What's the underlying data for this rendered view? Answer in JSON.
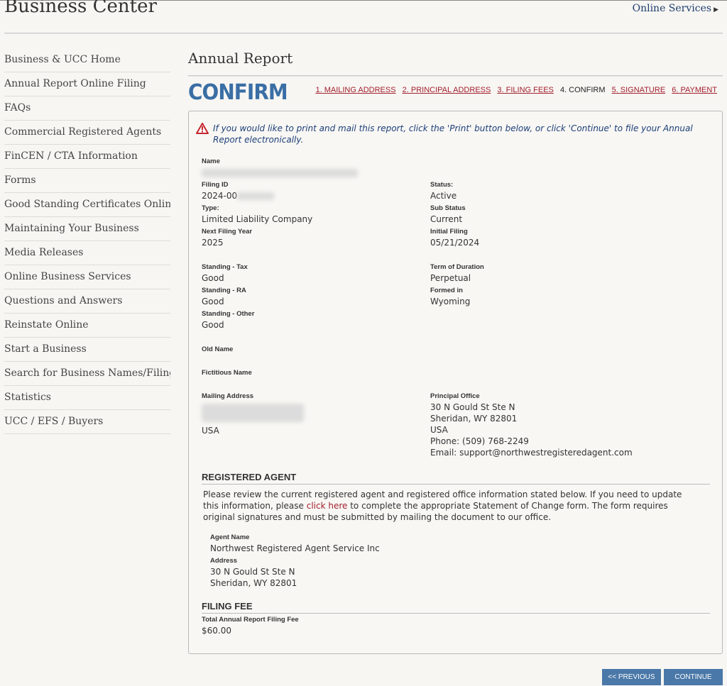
{
  "header": {
    "site_title": "Business Center",
    "online_services": "Online Services",
    "online_services_icon": "triangle-right-icon"
  },
  "sidebar": {
    "items": [
      "Business & UCC Home",
      "Annual Report Online Filing",
      "FAQs",
      "Commercial Registered Agents",
      "FinCEN / CTA Information",
      "Forms",
      "Good Standing Certificates Online",
      "Maintaining Your Business",
      "Media Releases",
      "Online Business Services",
      "Questions and Answers",
      "Reinstate Online",
      "Start a Business",
      "Search for Business Names/Filings",
      "Statistics",
      "UCC / EFS / Buyers"
    ]
  },
  "main": {
    "page_title": "Annual Report",
    "step_heading": "CONFIRM",
    "steps": [
      {
        "label": "1. MAILING ADDRESS",
        "state": "link"
      },
      {
        "label": "2. PRINCIPAL ADDRESS",
        "state": "link"
      },
      {
        "label": "3. FILING FEES",
        "state": "link"
      },
      {
        "label": "4. CONFIRM",
        "state": "current"
      },
      {
        "label": "5. SIGNATURE",
        "state": "link"
      },
      {
        "label": "6. PAYMENT",
        "state": "link"
      }
    ],
    "notice": "If you would like to print and mail this report, click the 'Print' button below, or click 'Continue' to file your Annual Report electronically.",
    "notice_icon": "warning-triangle-icon"
  },
  "fields": {
    "name_label": "Name",
    "filing_id_label": "Filing ID",
    "filing_id_value": "2024-00",
    "status_label": "Status:",
    "status_value": "Active",
    "type_label": "Type:",
    "type_value": "Limited Liability Company",
    "sub_status_label": "Sub Status",
    "sub_status_value": "Current",
    "next_filing_label": "Next Filing Year",
    "next_filing_value": "2025",
    "initial_filing_label": "Initial Filing",
    "initial_filing_value": "05/21/2024",
    "standing_tax_label": "Standing - Tax",
    "standing_tax_value": "Good",
    "term_label": "Term of Duration",
    "term_value": "Perpetual",
    "standing_ra_label": "Standing - RA",
    "standing_ra_value": "Good",
    "formed_in_label": "Formed in",
    "formed_in_value": "Wyoming",
    "standing_other_label": "Standing - Other",
    "standing_other_value": "Good",
    "old_name_label": "Old Name",
    "fictitious_name_label": "Fictitious Name",
    "mailing_label": "Mailing Address",
    "mailing_country": "USA",
    "principal_label": "Principal Office",
    "principal_line1": "30 N Gould St Ste N",
    "principal_line2": "Sheridan, WY 82801",
    "principal_country": "USA",
    "principal_phone": "Phone: (509) 768-2249",
    "principal_email": "Email: support@northwestregisteredagent.com"
  },
  "registered_agent": {
    "title": "REGISTERED AGENT",
    "text_before": "Please review the current registered agent and registered office information stated below. If you need to update this information, please ",
    "link": "click here",
    "text_after": " to complete the appropriate Statement of Change form. The form requires original signatures and must be submitted by mailing the document to our office.",
    "agent_name_label": "Agent Name",
    "agent_name_value": "Northwest Registered Agent Service Inc",
    "address_label": "Address",
    "address_line1": "30 N Gould St Ste N",
    "address_line2": "Sheridan, WY 82801"
  },
  "filing_fee": {
    "title": "FILING FEE",
    "total_label": "Total Annual Report Filing Fee",
    "total_value": "$60.00"
  },
  "buttons": {
    "previous": "<< PREVIOUS",
    "continue": "CONTINUE"
  }
}
